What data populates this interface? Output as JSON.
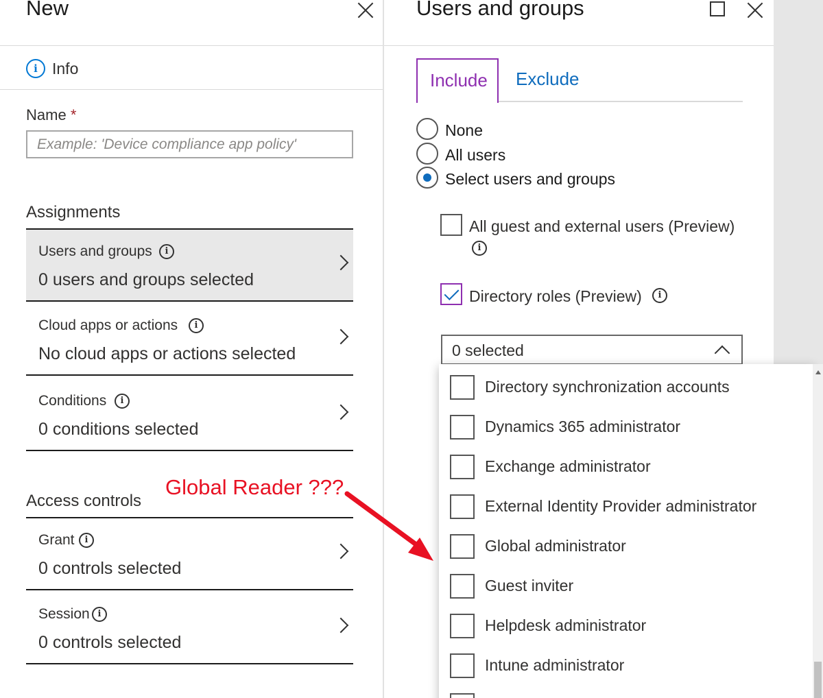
{
  "left_blade": {
    "title": "New",
    "info_label": "Info",
    "name_label": "Name",
    "required_mark": "*",
    "name_placeholder": "Example: 'Device compliance app policy'",
    "assignments_heading": "Assignments",
    "assignments": [
      {
        "title": "Users and groups",
        "value": "0 users and groups selected",
        "active": true
      },
      {
        "title": "Cloud apps or actions",
        "value": "No cloud apps or actions selected",
        "active": false
      },
      {
        "title": "Conditions",
        "value": "0 conditions selected",
        "active": false
      }
    ],
    "access_controls_heading": "Access controls",
    "access_controls": [
      {
        "title": "Grant",
        "value": "0 controls selected"
      },
      {
        "title": "Session",
        "value": "0 controls selected"
      }
    ]
  },
  "right_blade": {
    "title": "Users and groups",
    "tabs": [
      {
        "label": "Include",
        "selected": true
      },
      {
        "label": "Exclude",
        "selected": false
      }
    ],
    "radio_options": [
      {
        "label": "None",
        "checked": false
      },
      {
        "label": "All users",
        "checked": false
      },
      {
        "label": "Select users and groups",
        "checked": true
      }
    ],
    "guest_checkbox": {
      "label": "All guest and external users (Preview)",
      "checked": false
    },
    "roles_checkbox": {
      "label": "Directory roles (Preview)",
      "checked": true
    },
    "roles_select_value": "0 selected",
    "roles": [
      {
        "label": "Directory synchronization accounts",
        "checked": false
      },
      {
        "label": "Dynamics 365 administrator",
        "checked": false
      },
      {
        "label": "Exchange administrator",
        "checked": false
      },
      {
        "label": "External Identity Provider administrator",
        "checked": false
      },
      {
        "label": "Global administrator",
        "checked": false
      },
      {
        "label": "Guest inviter",
        "checked": false
      },
      {
        "label": "Helpdesk administrator",
        "checked": false
      },
      {
        "label": "Intune administrator",
        "checked": false
      },
      {
        "label": "",
        "checked": false
      }
    ]
  },
  "annotation": {
    "text": "Global Reader ???",
    "color": "#e81123"
  },
  "colors": {
    "accent_purple": "#8e2fb0",
    "link_blue": "#0f6cbd",
    "info_blue": "#0078d4",
    "required_red": "#a4262c"
  }
}
